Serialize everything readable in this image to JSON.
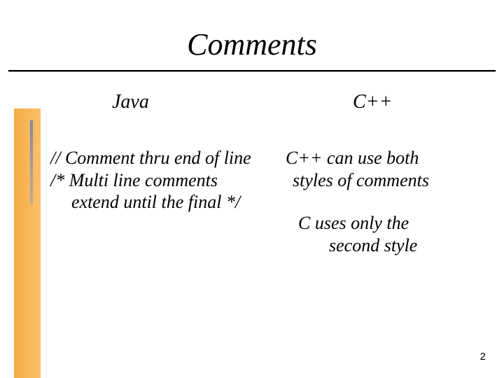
{
  "title": "Comments",
  "java": {
    "heading": "Java",
    "line1": "//  Comment thru end of line",
    "line2": "/* Multi line comments",
    "line3": "extend until the final */"
  },
  "cpp": {
    "heading": "C++",
    "note1_line1": "C++ can use both",
    "note1_line2": "styles of comments",
    "note2_line1": "C uses only the",
    "note2_line2": "second style"
  },
  "page_number": "2"
}
